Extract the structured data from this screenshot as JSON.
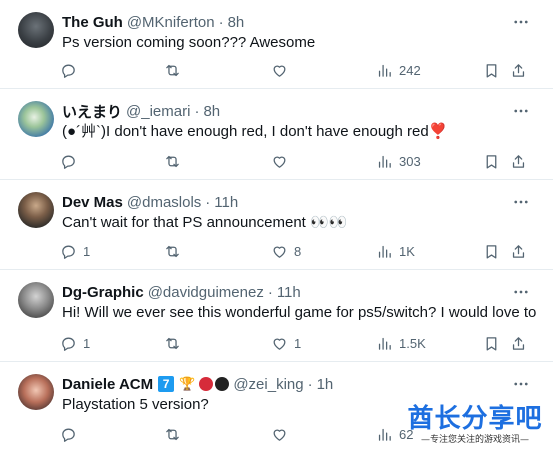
{
  "tweets": [
    {
      "name": "The Guh",
      "handle": "@MKniferton",
      "time": "8h",
      "text": "Ps version coming soon??? Awesome",
      "replies": "",
      "retweets": "",
      "likes": "",
      "views": "242",
      "avatar_icon": "ape-avatar"
    },
    {
      "name": "いえまり",
      "handle": "@_iemari",
      "time": "8h",
      "text": "(●´艸`)I don't have enough red, I don't have enough red❣️",
      "replies": "",
      "retweets": "",
      "likes": "",
      "views": "303",
      "avatar_icon": "anime-avatar"
    },
    {
      "name": "Dev Mas",
      "handle": "@dmaslols",
      "time": "11h",
      "text": "Can't wait for that PS announcement 👀👀",
      "replies": "1",
      "retweets": "",
      "likes": "8",
      "views": "1K",
      "avatar_icon": "person-avatar"
    },
    {
      "name": "Dg-Graphic",
      "handle": "@davidguimenez",
      "time": "11h",
      "text": "Hi! Will we ever see this wonderful game for ps5/switch? I would love to",
      "replies": "1",
      "retweets": "",
      "likes": "1",
      "views": "1.5K",
      "avatar_icon": "person-avatar"
    },
    {
      "name": "Daniele ACM",
      "handle": "@zei_king",
      "time": "1h",
      "text": "Playstation 5 version?",
      "replies": "",
      "retweets": "",
      "likes": "",
      "views": "62",
      "avatar_icon": "statue-avatar",
      "badges": [
        "7",
        "🏆"
      ]
    }
  ],
  "separator": "·",
  "watermark": {
    "title": "酋长分享吧",
    "subtitle": "—专注您关注的游戏资讯—"
  },
  "colors": {
    "text": "#0f1419",
    "secondary": "#536471",
    "border": "#e6ecf0",
    "watermark_blue": "#1d6fe0"
  }
}
